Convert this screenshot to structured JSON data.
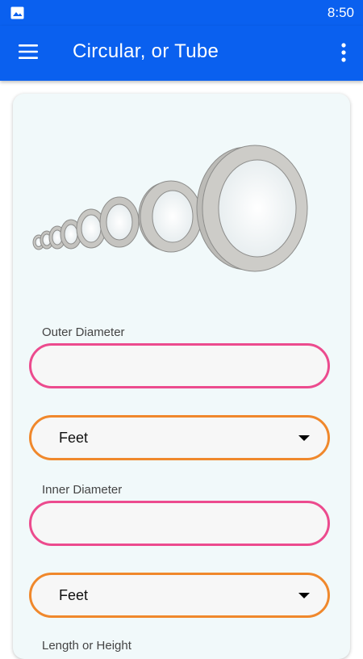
{
  "status_bar": {
    "time": "8:50",
    "icons": [
      "image-icon"
    ]
  },
  "app_bar": {
    "title": "Circular, or Tube",
    "icons": [
      "menu-icon",
      "more-vert-icon"
    ]
  },
  "colors": {
    "primary": "#0a60ef",
    "card_bg": "#f1f9fa",
    "input_border": "#ec4b8e",
    "select_border": "#f0882c"
  },
  "form": {
    "outer_diameter": {
      "label": "Outer Diameter",
      "value": "",
      "unit": "Feet"
    },
    "inner_diameter": {
      "label": "Inner Diameter",
      "value": "",
      "unit": "Feet"
    },
    "length": {
      "label": "Length or Height"
    }
  }
}
